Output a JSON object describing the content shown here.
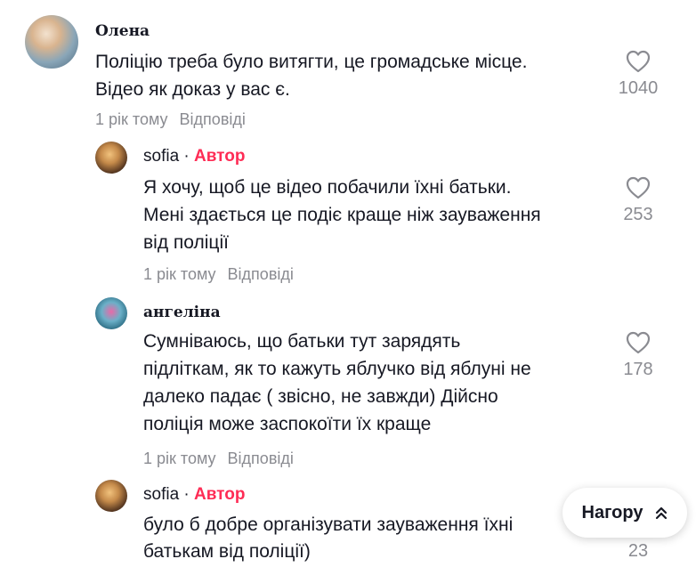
{
  "comments": [
    {
      "author": "Олена",
      "lines": [
        "Поліцію треба було витягти, це громадське місце.",
        "Відео як доказ у вас є."
      ],
      "time": "1 рік тому",
      "reply_label": "Відповіді",
      "likes": "1040"
    }
  ],
  "replies": [
    {
      "author": "sofia",
      "separator": "·",
      "badge": "Автор",
      "lines": [
        "Я хочу, щоб це відео побачили їхні батьки.",
        "Мені здається це подіє краще ніж зауваження",
        "від поліції"
      ],
      "time": "1 рік тому",
      "reply_label": "Відповіді",
      "likes": "253"
    },
    {
      "author": "ангеліна",
      "lines": [
        "Сумніваюсь, що батьки тут зарядять",
        "підліткам, як то кажуть яблучко від яблуні не",
        "далеко падає ( звісно, не завжди) Дійсно",
        "поліція може заспокоїти їх краще"
      ],
      "time": "1 рік тому",
      "reply_label": "Відповіді",
      "likes": "178"
    },
    {
      "author": "sofia",
      "separator": "·",
      "badge": "Автор",
      "lines": [
        "було б добре організувати зауваження їхні",
        "батькам від поліції)"
      ],
      "likes": "23"
    }
  ],
  "scroll_top": {
    "label": "Нагору",
    "icon": "double-chevron-up-icon"
  },
  "colors": {
    "author_badge": "#fe2c55",
    "meta_text": "#8a8b91",
    "text": "#161823"
  }
}
